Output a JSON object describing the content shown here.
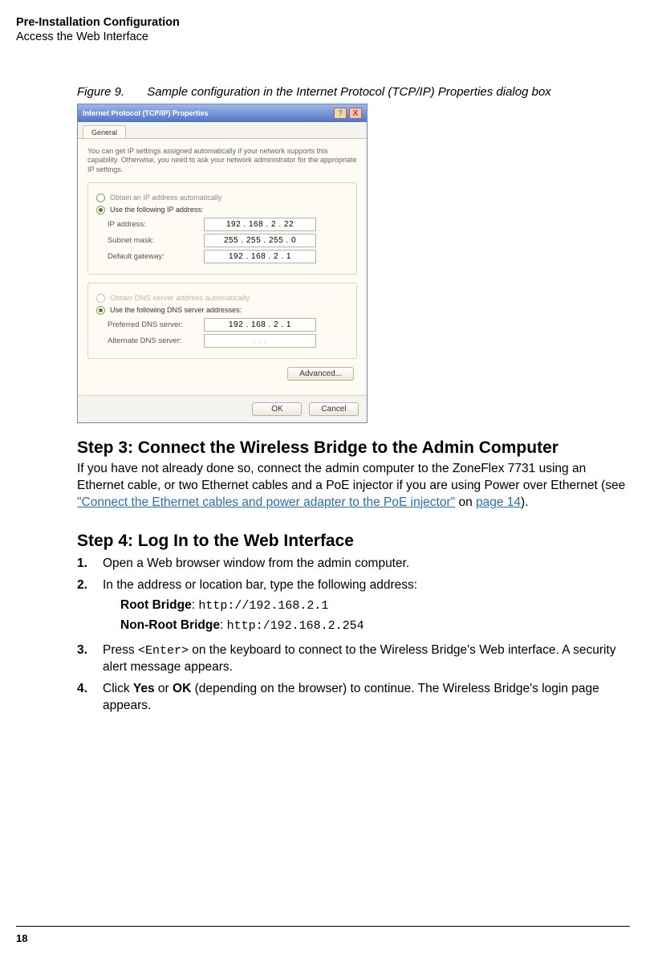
{
  "header": {
    "title": "Pre-Installation Configuration",
    "subtitle": "Access the Web Interface"
  },
  "figure": {
    "label": "Figure 9.",
    "caption": "Sample configuration in the Internet Protocol (TCP/IP) Properties dialog box"
  },
  "dialog": {
    "title": "Internet Protocol (TCP/IP) Properties",
    "help_icon": "?",
    "close_icon": "X",
    "tab": "General",
    "intro": "You can get IP settings assigned automatically if your network supports this capability. Otherwise, you need to ask your network administrator for the appropriate IP settings.",
    "opt_auto_ip": "Obtain an IP address automatically",
    "opt_use_ip": "Use the following IP address:",
    "ip_address_label": "IP address:",
    "ip_address_value": "192 . 168 .   2   .  22",
    "subnet_label": "Subnet mask:",
    "subnet_value": "255 . 255 . 255 .   0",
    "gateway_label": "Default gateway:",
    "gateway_value": "192 . 168 .   2   .   1",
    "opt_auto_dns": "Obtain DNS server address automatically",
    "opt_use_dns": "Use the following DNS server addresses:",
    "pref_dns_label": "Preferred DNS server:",
    "pref_dns_value": "192 . 168 .   2   .   1",
    "alt_dns_label": "Alternate DNS server:",
    "alt_dns_value": ".        .        .",
    "advanced_btn": "Advanced...",
    "ok_btn": "OK",
    "cancel_btn": "Cancel"
  },
  "step3": {
    "heading": "Step 3: Connect the Wireless Bridge to the Admin Computer",
    "body1": "If you have not already done so, connect the admin computer to the ZoneFlex 7731 using an Ethernet cable, or two Ethernet cables and a PoE injector if you are using Power over Ethernet (see ",
    "link1": "\"Connect the Ethernet cables and power adapter to the PoE injector\"",
    "mid": " on ",
    "link2": "page 14",
    "end": ")."
  },
  "step4": {
    "heading": "Step 4: Log In to the Web Interface",
    "items": {
      "n1": "1.",
      "t1": "Open a Web browser window from the admin computer.",
      "n2": "2.",
      "t2": "In the address or location bar, type the following address:",
      "root_label": "Root Bridge",
      "root_url": "http://192.168.2.1",
      "nonroot_label": "Non-Root Bridge",
      "nonroot_url": "http:/192.168.2.254",
      "n3": "3.",
      "t3a": "Press ",
      "t3key": "<Enter>",
      "t3b": " on the keyboard to connect to the Wireless Bridge's Web interface. A security alert message appears.",
      "n4": "4.",
      "t4a": "Click ",
      "t4yes": "Yes",
      "t4or": " or ",
      "t4ok": "OK",
      "t4b": " (depending on the browser) to continue. The Wireless Bridge's login page appears."
    }
  },
  "page_number": "18"
}
